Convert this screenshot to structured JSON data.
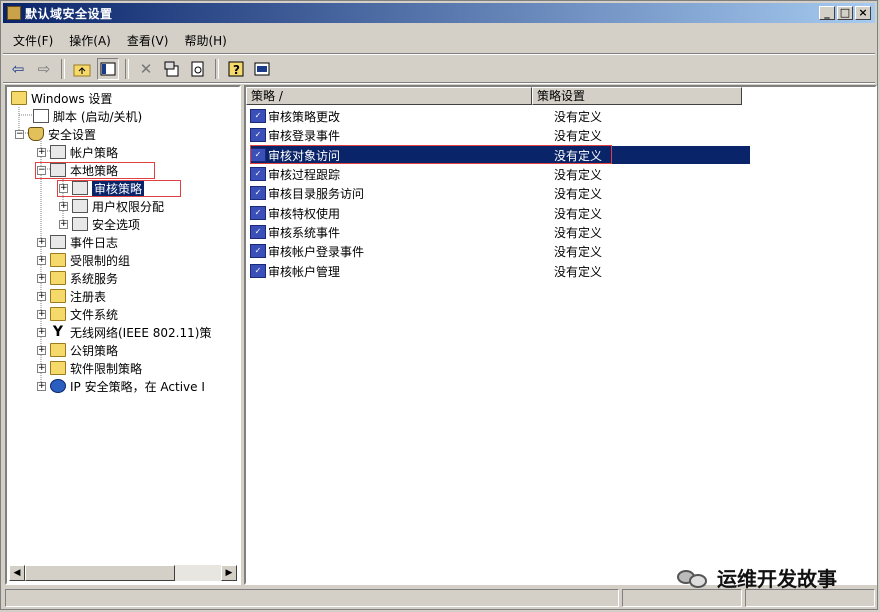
{
  "window": {
    "title": "默认域安全设置",
    "min_label": "_",
    "max_label": "□",
    "close_label": "×"
  },
  "menubar": [
    "文件(F)",
    "操作(A)",
    "查看(V)",
    "帮助(H)"
  ],
  "toolbar": [
    "back-icon",
    "forward-icon",
    "up-folder-icon",
    "show-hide-tree-icon",
    "delete-icon",
    "properties-icon",
    "refresh-icon",
    "help-icon",
    "console-icon"
  ],
  "tree": [
    {
      "label": "Windows 设置",
      "icon": "folder-icon",
      "expander": ""
    },
    {
      "label": "脚本 (启动/关机)",
      "icon": "script-icon",
      "expander": ""
    },
    {
      "label": "安全设置",
      "icon": "shield-icon",
      "expander": "−"
    },
    {
      "label": "帐户策略",
      "icon": "policy-icon",
      "expander": "+"
    },
    {
      "label": "本地策略",
      "icon": "policy-icon",
      "expander": "−"
    },
    {
      "label": "审核策略",
      "icon": "policy-icon",
      "expander": "+"
    },
    {
      "label": "用户权限分配",
      "icon": "policy-icon",
      "expander": "+"
    },
    {
      "label": "安全选项",
      "icon": "policy-icon",
      "expander": "+"
    },
    {
      "label": "事件日志",
      "icon": "policy-icon",
      "expander": "+"
    },
    {
      "label": "受限制的组",
      "icon": "folder-icon",
      "expander": "+"
    },
    {
      "label": "系统服务",
      "icon": "folder-icon",
      "expander": "+"
    },
    {
      "label": "注册表",
      "icon": "folder-icon",
      "expander": "+"
    },
    {
      "label": "文件系统",
      "icon": "folder-icon",
      "expander": "+"
    },
    {
      "label": "无线网络(IEEE 802.11)策",
      "icon": "antenna-icon",
      "expander": "+"
    },
    {
      "label": "公钥策略",
      "icon": "folder-icon",
      "expander": "+"
    },
    {
      "label": "软件限制策略",
      "icon": "folder-icon",
      "expander": "+"
    },
    {
      "label": "IP 安全策略，在 Active I",
      "icon": "ipsec-icon",
      "expander": "+"
    }
  ],
  "list": {
    "columns": [
      "策略 /",
      "策略设置"
    ],
    "rows": [
      {
        "name": "审核策略更改",
        "value": "没有定义"
      },
      {
        "name": "审核登录事件",
        "value": "没有定义"
      },
      {
        "name": "审核对象访问",
        "value": "没有定义"
      },
      {
        "name": "审核过程跟踪",
        "value": "没有定义"
      },
      {
        "name": "审核目录服务访问",
        "value": "没有定义"
      },
      {
        "name": "审核特权使用",
        "value": "没有定义"
      },
      {
        "name": "审核系统事件",
        "value": "没有定义"
      },
      {
        "name": "审核帐户登录事件",
        "value": "没有定义"
      },
      {
        "name": "审核帐户管理",
        "value": "没有定义"
      }
    ]
  },
  "watermark": {
    "text": "运维开发故事"
  },
  "scroll": {
    "left": "◀",
    "right": "▶"
  }
}
